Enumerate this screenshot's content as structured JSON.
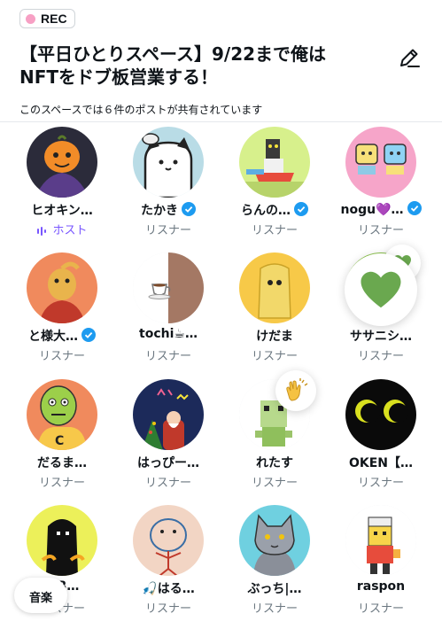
{
  "rec": {
    "label": "REC",
    "dot_color": "#f7a0c4"
  },
  "space": {
    "title_line1": "【平日ひとりスペース】9/22まで俺は",
    "title_line2": "NFTをドブ板営業する！",
    "subtitle": "このスペースでは６件のポストが共有されています"
  },
  "colors": {
    "accent": "#1d9bf0",
    "host": "#7856ff",
    "muted": "#6b7780",
    "text": "#0f1419"
  },
  "participants": [
    {
      "name": "ヒオキン…",
      "role": "ホスト",
      "is_host": true,
      "verified": false,
      "avatar_bg": "#2b2b3a"
    },
    {
      "name": "たかき",
      "role": "リスナー",
      "is_host": false,
      "verified": true,
      "avatar_bg": "#b9dce6"
    },
    {
      "name": "らんの…",
      "role": "リスナー",
      "is_host": false,
      "verified": true,
      "avatar_bg": "#d7f08c"
    },
    {
      "name": "nogu💜…",
      "role": "リスナー",
      "is_host": false,
      "verified": true,
      "avatar_bg": "#f6a5c9"
    },
    {
      "name": "と様大…",
      "role": "リスナー",
      "is_host": false,
      "verified": true,
      "avatar_bg": "#f08a5d"
    },
    {
      "name": "tochi☕…",
      "role": "リスナー",
      "is_host": false,
      "verified": false,
      "avatar_bg": "#ffffff"
    },
    {
      "name": "けだま",
      "role": "リスナー",
      "is_host": false,
      "verified": false,
      "avatar_bg": "#f7c948"
    },
    {
      "name": "ササニシ…",
      "role": "リスナー",
      "is_host": false,
      "verified": false,
      "avatar_bg": "#8bc34a"
    },
    {
      "name": "だるま…",
      "role": "リスナー",
      "is_host": false,
      "verified": false,
      "avatar_bg": "#f08a5d"
    },
    {
      "name": "はっぴー…",
      "role": "リスナー",
      "is_host": false,
      "verified": false,
      "avatar_bg": "#1c2a5a"
    },
    {
      "name": "れたす",
      "role": "リスナー",
      "is_host": false,
      "verified": false,
      "avatar_bg": "#ffffff"
    },
    {
      "name": "OKEN【…",
      "role": "リスナー",
      "is_host": false,
      "verified": false,
      "avatar_bg": "#0a0a0a"
    },
    {
      "name": "…B…",
      "role": "リスナー",
      "is_host": false,
      "verified": false,
      "avatar_bg": "#ecf05a"
    },
    {
      "name": "🎣はる…",
      "role": "リスナー",
      "is_host": false,
      "verified": false,
      "avatar_bg": "#f2d5c4"
    },
    {
      "name": "ぶっち|…",
      "role": "リスナー",
      "is_host": false,
      "verified": false,
      "avatar_bg": "#6fd0e0"
    },
    {
      "name": "raspon",
      "role": "リスナー",
      "is_host": false,
      "verified": false,
      "avatar_bg": "#ffffff"
    }
  ],
  "reactions": [
    {
      "icon": "green-heart-icon",
      "color": "#6aa84f"
    },
    {
      "icon": "clapping-hands-icon",
      "color": "#f5c242"
    }
  ],
  "music_chip": {
    "label": "音楽"
  }
}
